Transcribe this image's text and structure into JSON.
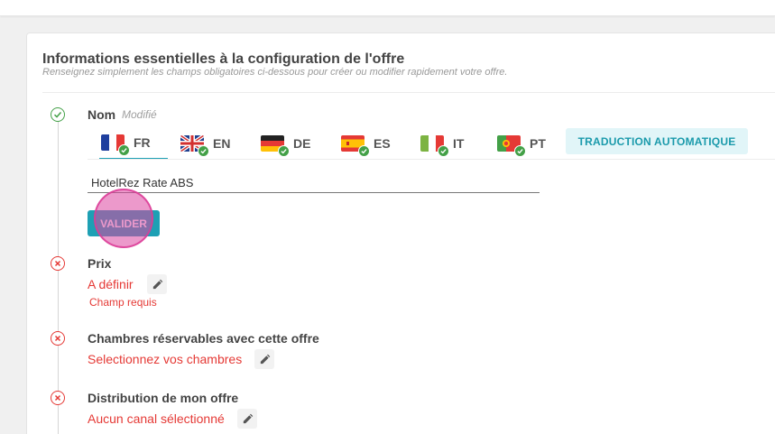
{
  "section": {
    "title": "Informations essentielles à la configuration de l'offre",
    "subtitle": "Renseignez simplement les champs obligatoires ci-dessous pour créer ou modifier rapidement votre offre."
  },
  "name_field": {
    "label": "Nom",
    "status_text": "Modifié",
    "status": "ok",
    "languages": [
      {
        "code": "FR",
        "flag": "france-flag",
        "active": true,
        "translated": true
      },
      {
        "code": "EN",
        "flag": "uk-flag",
        "active": false,
        "translated": true
      },
      {
        "code": "DE",
        "flag": "germany-flag",
        "active": false,
        "translated": true
      },
      {
        "code": "ES",
        "flag": "spain-flag",
        "active": false,
        "translated": true
      },
      {
        "code": "IT",
        "flag": "italy-flag",
        "active": false,
        "translated": true
      },
      {
        "code": "PT",
        "flag": "portugal-flag",
        "active": false,
        "translated": true
      }
    ],
    "auto_translate_label": "TRADUCTION AUTOMATIQUE",
    "value": "HotelRez Rate ABS",
    "submit_label": "VALIDER"
  },
  "price_field": {
    "label": "Prix",
    "status": "error",
    "value": "A définir",
    "error": "Champ requis"
  },
  "rooms_field": {
    "label": "Chambres réservables avec cette offre",
    "status": "error",
    "value": "Selectionnez vos chambres"
  },
  "distribution_field": {
    "label": "Distribution de mon offre",
    "status": "error",
    "value": "Aucun canal sélectionné"
  },
  "colors": {
    "accent": "#1ea0b4",
    "error": "#e53935",
    "success": "#43a047"
  }
}
